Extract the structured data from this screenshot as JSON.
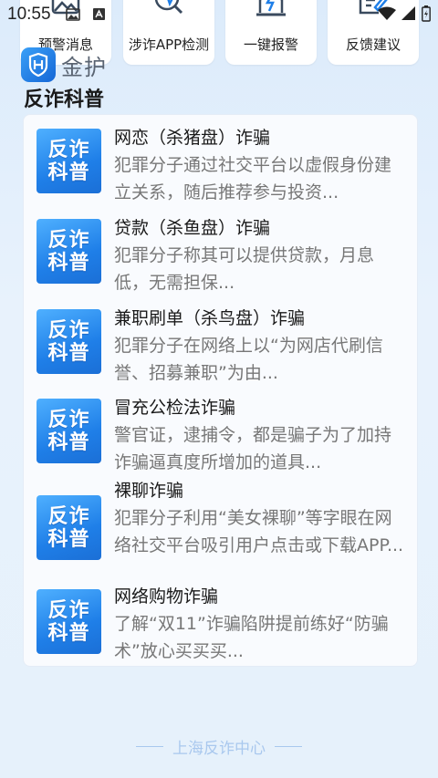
{
  "status_bar": {
    "time": "10:55"
  },
  "shortcuts": [
    {
      "label": "预警消息",
      "icon": "alert-envelope-icon"
    },
    {
      "label": "涉诈APP检测",
      "icon": "app-scan-icon"
    },
    {
      "label": "一键报警",
      "icon": "alarm-light-icon"
    },
    {
      "label": "反馈建议",
      "icon": "feedback-edit-icon"
    }
  ],
  "brand": {
    "name": "金护"
  },
  "section": {
    "title": "反诈科普"
  },
  "thumb_text": {
    "line1": "反诈",
    "line2": "科普"
  },
  "articles": [
    {
      "title": "网恋（杀猪盘）诈骗",
      "desc": "犯罪分子通过社交平台以虚假身份建立关系，随后推荐参与投资..."
    },
    {
      "title": "贷款（杀鱼盘）诈骗",
      "desc": "犯罪分子称其可以提供贷款，月息低，无需担保..."
    },
    {
      "title": "兼职刷单（杀鸟盘）诈骗",
      "desc": "犯罪分子在网络上以“为网店代刷信誉、招募兼职”为由..."
    },
    {
      "title": "冒充公检法诈骗",
      "desc": "警官证，逮捕令，都是骗子为了加持诈骗逼真度所增加的道具..."
    },
    {
      "title": "裸聊诈骗",
      "desc": "犯罪分子利用“美女裸聊”等字眼在网络社交平台吸引用户点击或下载APP..."
    },
    {
      "title": "网络购物诈骗",
      "desc": "了解“双11”诈骗陷阱提前练好“防骗术”放心买买买..."
    }
  ],
  "footer": {
    "text": "上海反诈中心"
  },
  "colors": {
    "accent": "#1f7fe8",
    "background": "#e3effb",
    "footer": "#a9c8ee"
  }
}
